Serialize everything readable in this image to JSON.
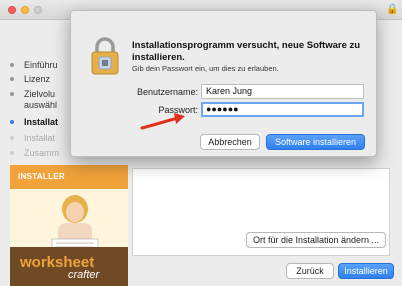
{
  "background_window": {
    "steps": [
      {
        "label": "Einführu",
        "state": "done"
      },
      {
        "label": "Lizenz",
        "state": "done"
      },
      {
        "label": "Zielvolu",
        "state": "done"
      },
      {
        "label": "auswähl",
        "state": "done-cont"
      },
      {
        "label": "Installat",
        "state": "active"
      },
      {
        "label": "Installat",
        "state": "dim"
      },
      {
        "label": "Zusamm",
        "state": "dim"
      }
    ],
    "promo": {
      "title": "INSTALLER",
      "brand": "worksheet",
      "sub": "crafter"
    },
    "change_location_label": "Ort für die Installation ändern ...",
    "back_label": "Zurück",
    "install_label": "Installieren"
  },
  "dialog": {
    "title": "Installationsprogramm versucht, neue Software zu installieren.",
    "subtitle": "Gib dein Passwort ein, um dies zu erlauben.",
    "username_label": "Benutzername:",
    "username_value": "Karen Jung",
    "password_label": "Passwort:",
    "password_value": "●●●●●●",
    "cancel_label": "Abbrechen",
    "confirm_label": "Software installieren"
  },
  "colors": {
    "accent": "#3a7be0",
    "arrow": "#e0301e",
    "promo_orange": "#f0a23b"
  },
  "icons": [
    "lock-icon",
    "red-arrow-icon",
    "titlebar-lock-icon"
  ]
}
